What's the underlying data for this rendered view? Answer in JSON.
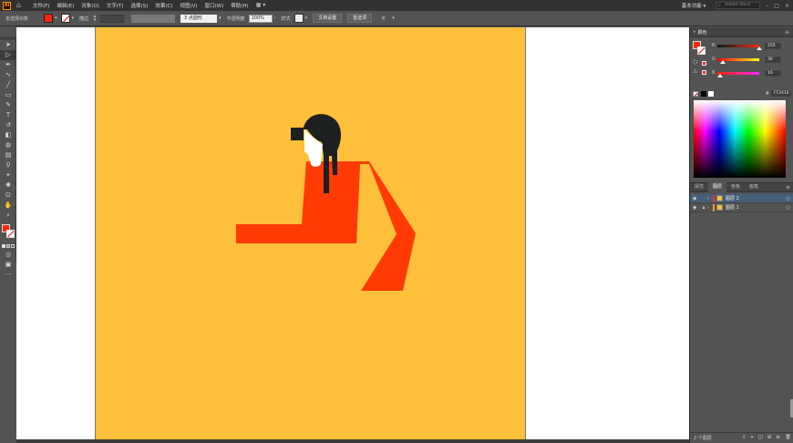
{
  "menubar": {
    "logo": "Ai",
    "items": [
      "文件(F)",
      "编辑(E)",
      "对象(O)",
      "文字(T)",
      "选择(S)",
      "效果(C)",
      "视图(V)",
      "窗口(W)",
      "帮助(H)"
    ],
    "layout_icon": "▦ ▾",
    "workspace": "基本功能 ▾",
    "search_placeholder": "Adobe Stock"
  },
  "controlbar": {
    "selection_status": "未选择对象",
    "stroke_label": "描边",
    "brush_value": "3 点圆形",
    "opacity_label": "不透明度",
    "opacity_value": "100%",
    "style_label": "样式",
    "doc_setup_button": "文档设置",
    "preferences_button": "首选项"
  },
  "colors": {
    "fill": "#ff2410",
    "artboard": "#fec03a",
    "hair": "#1d2021",
    "skin": "#ffffff"
  },
  "color_panel": {
    "title": "颜色",
    "channels": [
      {
        "label": "R",
        "value": "255",
        "fraction": 1.0,
        "gradient": "linear-gradient(to right, #002410, #ff2410)"
      },
      {
        "label": "G",
        "value": "36",
        "fraction": 0.14,
        "gradient": "linear-gradient(to right, #ff0010, #ffff10)"
      },
      {
        "label": "B",
        "value": "16",
        "fraction": 0.06,
        "gradient": "linear-gradient(to right, #ff2400, #ff24ff)"
      }
    ],
    "hex_label": "#",
    "hex_value": "FF2410"
  },
  "layers_panel": {
    "tabs": [
      "属性",
      "图层",
      "色板",
      "画笔"
    ],
    "active_tab": 1,
    "layers": [
      {
        "name": "图层 2",
        "color": "#ff3030",
        "thumb": "#fec03a",
        "selected": true
      },
      {
        "name": "图层 1",
        "color": "#ff9a2a",
        "thumb": "#fec03a",
        "selected": false
      }
    ],
    "count_label": "2 个图层"
  },
  "toolbar": {
    "tools": [
      "selection-tool",
      "direct-selection-tool",
      "pen-tool",
      "curvature-tool",
      "line-tool",
      "rectangle-tool",
      "paintbrush-tool",
      "type-tool",
      "rotate-tool",
      "eraser-tool",
      "shape-builder-tool",
      "gradient-tool",
      "eyedropper-tool",
      "blend-tool",
      "symbol-sprayer-tool",
      "artboard-tool",
      "hand-tool",
      "zoom-tool"
    ]
  }
}
